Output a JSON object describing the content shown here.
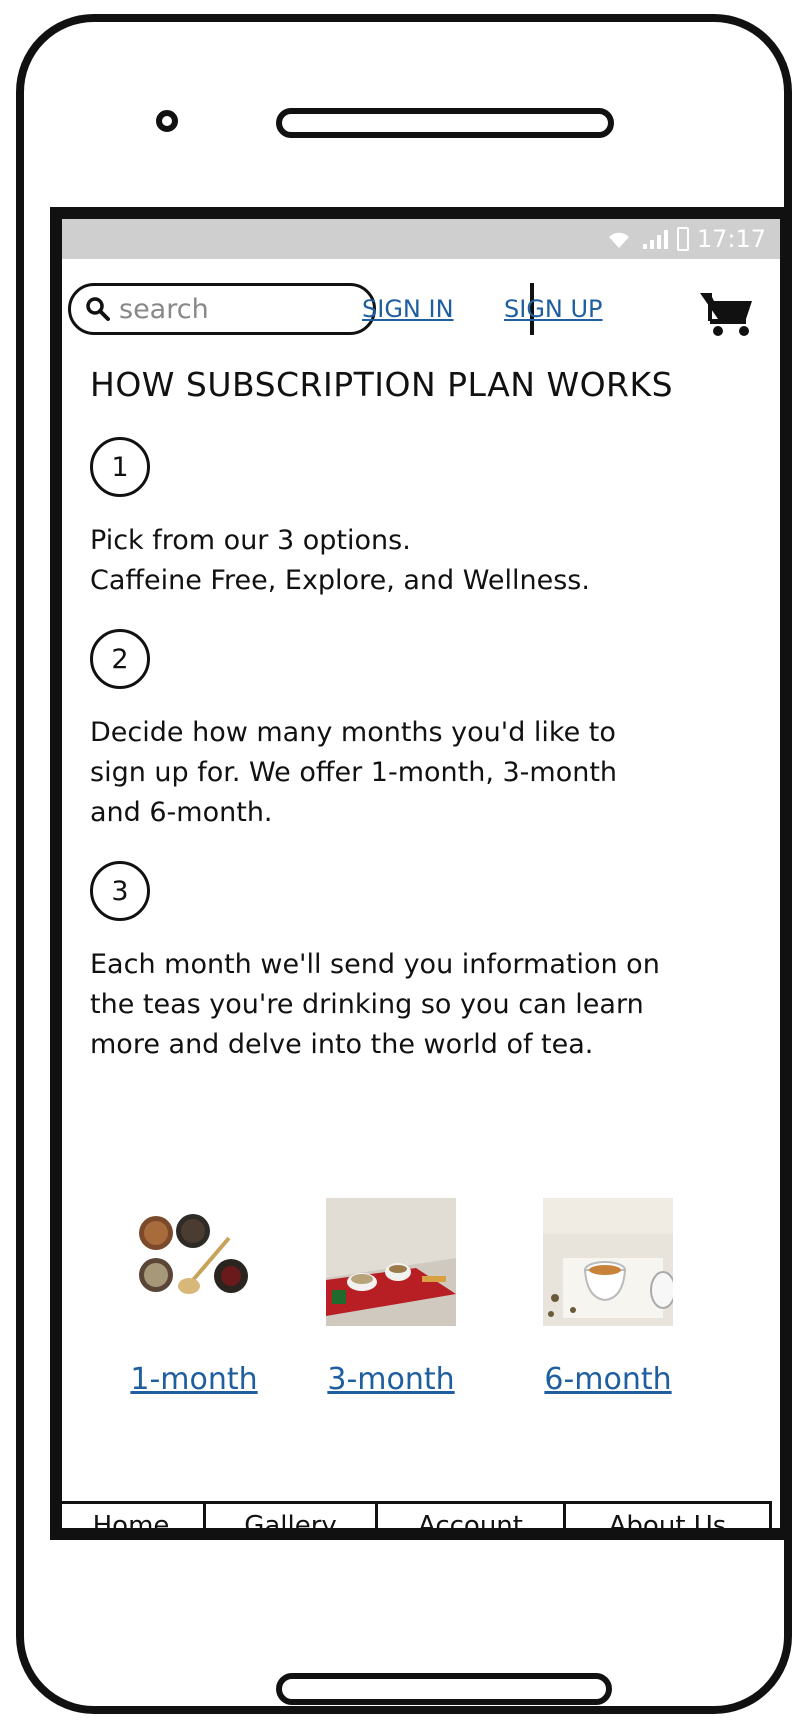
{
  "status_bar": {
    "time": "17:17"
  },
  "header": {
    "search": {
      "placeholder": "search"
    },
    "sign_in": "SIGN IN",
    "sign_up": "SIGN UP"
  },
  "main": {
    "title": "HOW SUBSCRIPTION PLAN WORKS",
    "steps": [
      {
        "number": "1",
        "lines": [
          "Pick from our 3 options.",
          "Caffeine Free, Explore, and Wellness."
        ]
      },
      {
        "number": "2",
        "lines": [
          "Decide how many months you'd like to",
          "sign up for. We offer 1-month, 3-month",
          "and 6-month."
        ]
      },
      {
        "number": "3",
        "lines": [
          "Each month we'll send you information on",
          "the teas you're drinking so you can learn",
          "more and delve into the world of tea."
        ]
      }
    ],
    "plans": [
      {
        "label": "1-month"
      },
      {
        "label": "3-month"
      },
      {
        "label": "6-month"
      }
    ]
  },
  "bottom_nav": {
    "items": [
      {
        "label": "Home"
      },
      {
        "label": "Gallery"
      },
      {
        "label": "Account"
      },
      {
        "label": "About Us"
      }
    ]
  },
  "colors": {
    "link": "#1f5fa0",
    "status_bar": "#cfcfcf",
    "outline": "#111111"
  }
}
